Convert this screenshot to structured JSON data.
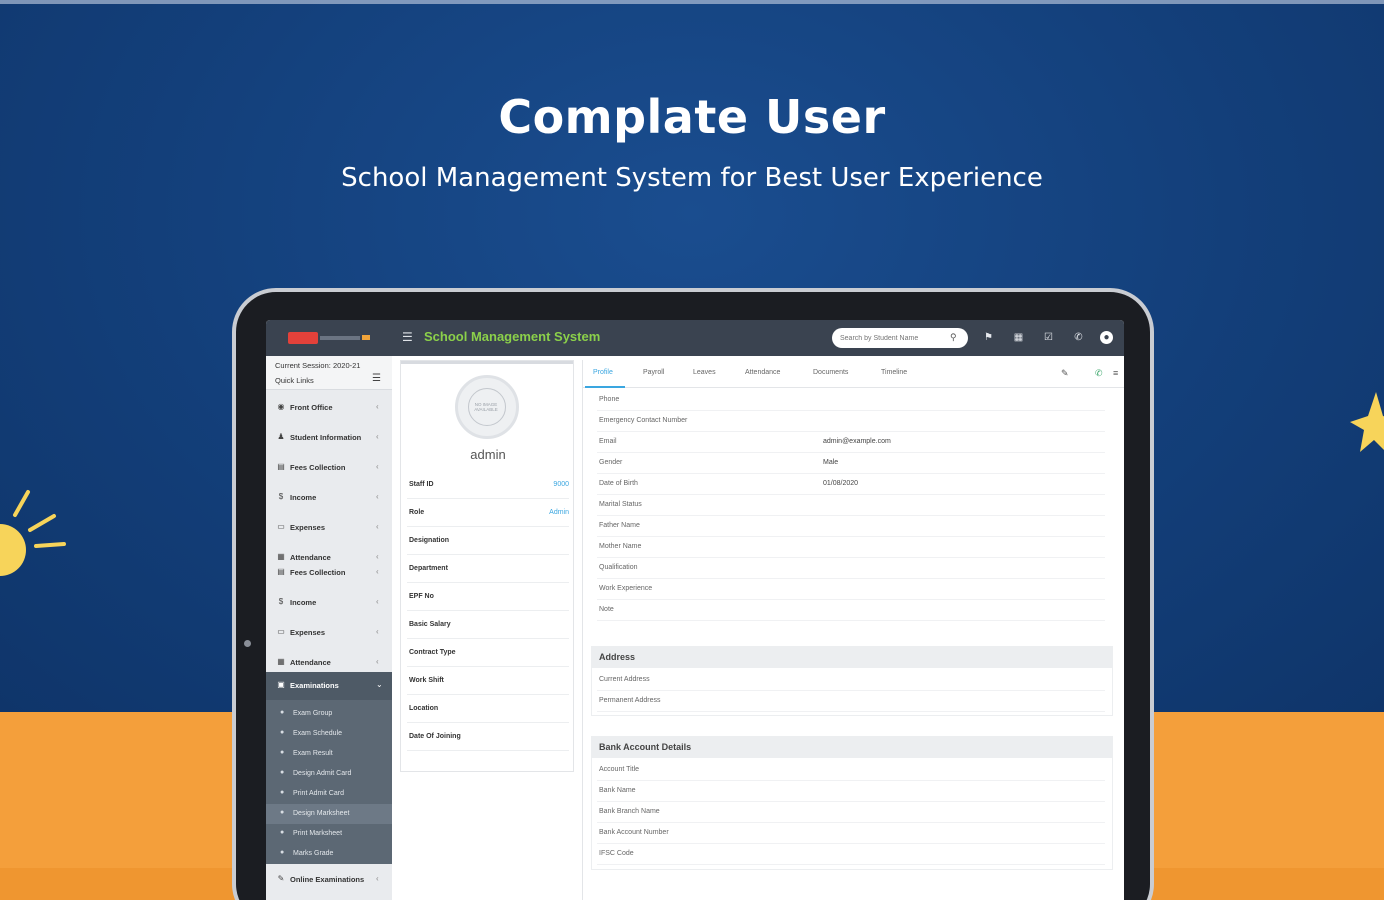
{
  "hero": {
    "title": "Complate User",
    "subtitle": "School Management System for Best User Experience"
  },
  "colors": {
    "background_top": "#133f7a",
    "background_bottom": "#f49f3b",
    "app_title": "#8bd04a",
    "topbar": "#3a4350",
    "accent_link": "#3aa6e0"
  },
  "app": {
    "title": "School Management System",
    "menu_icon": "hamburger-icon",
    "search_placeholder": "Search by Student Name",
    "top_icons": [
      "flag-icon",
      "calendar-icon",
      "task-icon",
      "whatsapp-icon",
      "user-avatar-icon"
    ]
  },
  "sidebar": {
    "session_label": "Current Session: 2020-21",
    "quick_links": "Quick Links",
    "items": [
      {
        "label": "Front Office",
        "icon": "front-office-icon"
      },
      {
        "label": "Student Information",
        "icon": "student-icon"
      },
      {
        "label": "Fees Collection",
        "icon": "fees-icon"
      },
      {
        "label": "Income",
        "icon": "income-icon"
      },
      {
        "label": "Expenses",
        "icon": "expenses-icon"
      },
      {
        "label": "Attendance",
        "icon": "attendance-icon"
      },
      {
        "label": "Fees Collection",
        "icon": "fees-icon"
      },
      {
        "label": "Income",
        "icon": "income-icon"
      },
      {
        "label": "Expenses",
        "icon": "expenses-icon"
      },
      {
        "label": "Attendance",
        "icon": "attendance-icon"
      },
      {
        "label": "Examinations",
        "icon": "exam-icon"
      },
      {
        "label": "Online Examinations",
        "icon": "online-exam-icon"
      }
    ],
    "submenu": [
      "Exam Group",
      "Exam Schedule",
      "Exam Result",
      "Design Admit Card",
      "Print Admit Card",
      "Design Marksheet",
      "Print Marksheet",
      "Marks Grade"
    ]
  },
  "profile": {
    "avatar_text": "NO IMAGE AVAILABLE",
    "name": "admin",
    "fields": [
      {
        "label": "Staff ID",
        "value": "9000"
      },
      {
        "label": "Role",
        "value": "Admin"
      },
      {
        "label": "Designation",
        "value": ""
      },
      {
        "label": "Department",
        "value": ""
      },
      {
        "label": "EPF No",
        "value": ""
      },
      {
        "label": "Basic Salary",
        "value": ""
      },
      {
        "label": "Contract Type",
        "value": ""
      },
      {
        "label": "Work Shift",
        "value": ""
      },
      {
        "label": "Location",
        "value": ""
      },
      {
        "label": "Date Of Joining",
        "value": ""
      }
    ]
  },
  "tabs": [
    "Profile",
    "Payroll",
    "Leaves",
    "Attendance",
    "Documents",
    "Timeline"
  ],
  "details": [
    {
      "label": "Phone",
      "value": ""
    },
    {
      "label": "Emergency Contact Number",
      "value": ""
    },
    {
      "label": "Email",
      "value": "admin@example.com"
    },
    {
      "label": "Gender",
      "value": "Male"
    },
    {
      "label": "Date of Birth",
      "value": "01/08/2020"
    },
    {
      "label": "Marital Status",
      "value": ""
    },
    {
      "label": "Father Name",
      "value": ""
    },
    {
      "label": "Mother Name",
      "value": ""
    },
    {
      "label": "Qualification",
      "value": ""
    },
    {
      "label": "Work Experience",
      "value": ""
    },
    {
      "label": "Note",
      "value": ""
    }
  ],
  "address": {
    "heading": "Address",
    "rows": [
      "Current Address",
      "Permanent Address"
    ]
  },
  "bank": {
    "heading": "Bank Account Details",
    "rows": [
      "Account Title",
      "Bank Name",
      "Bank Branch Name",
      "Bank Account Number",
      "IFSC Code"
    ]
  }
}
